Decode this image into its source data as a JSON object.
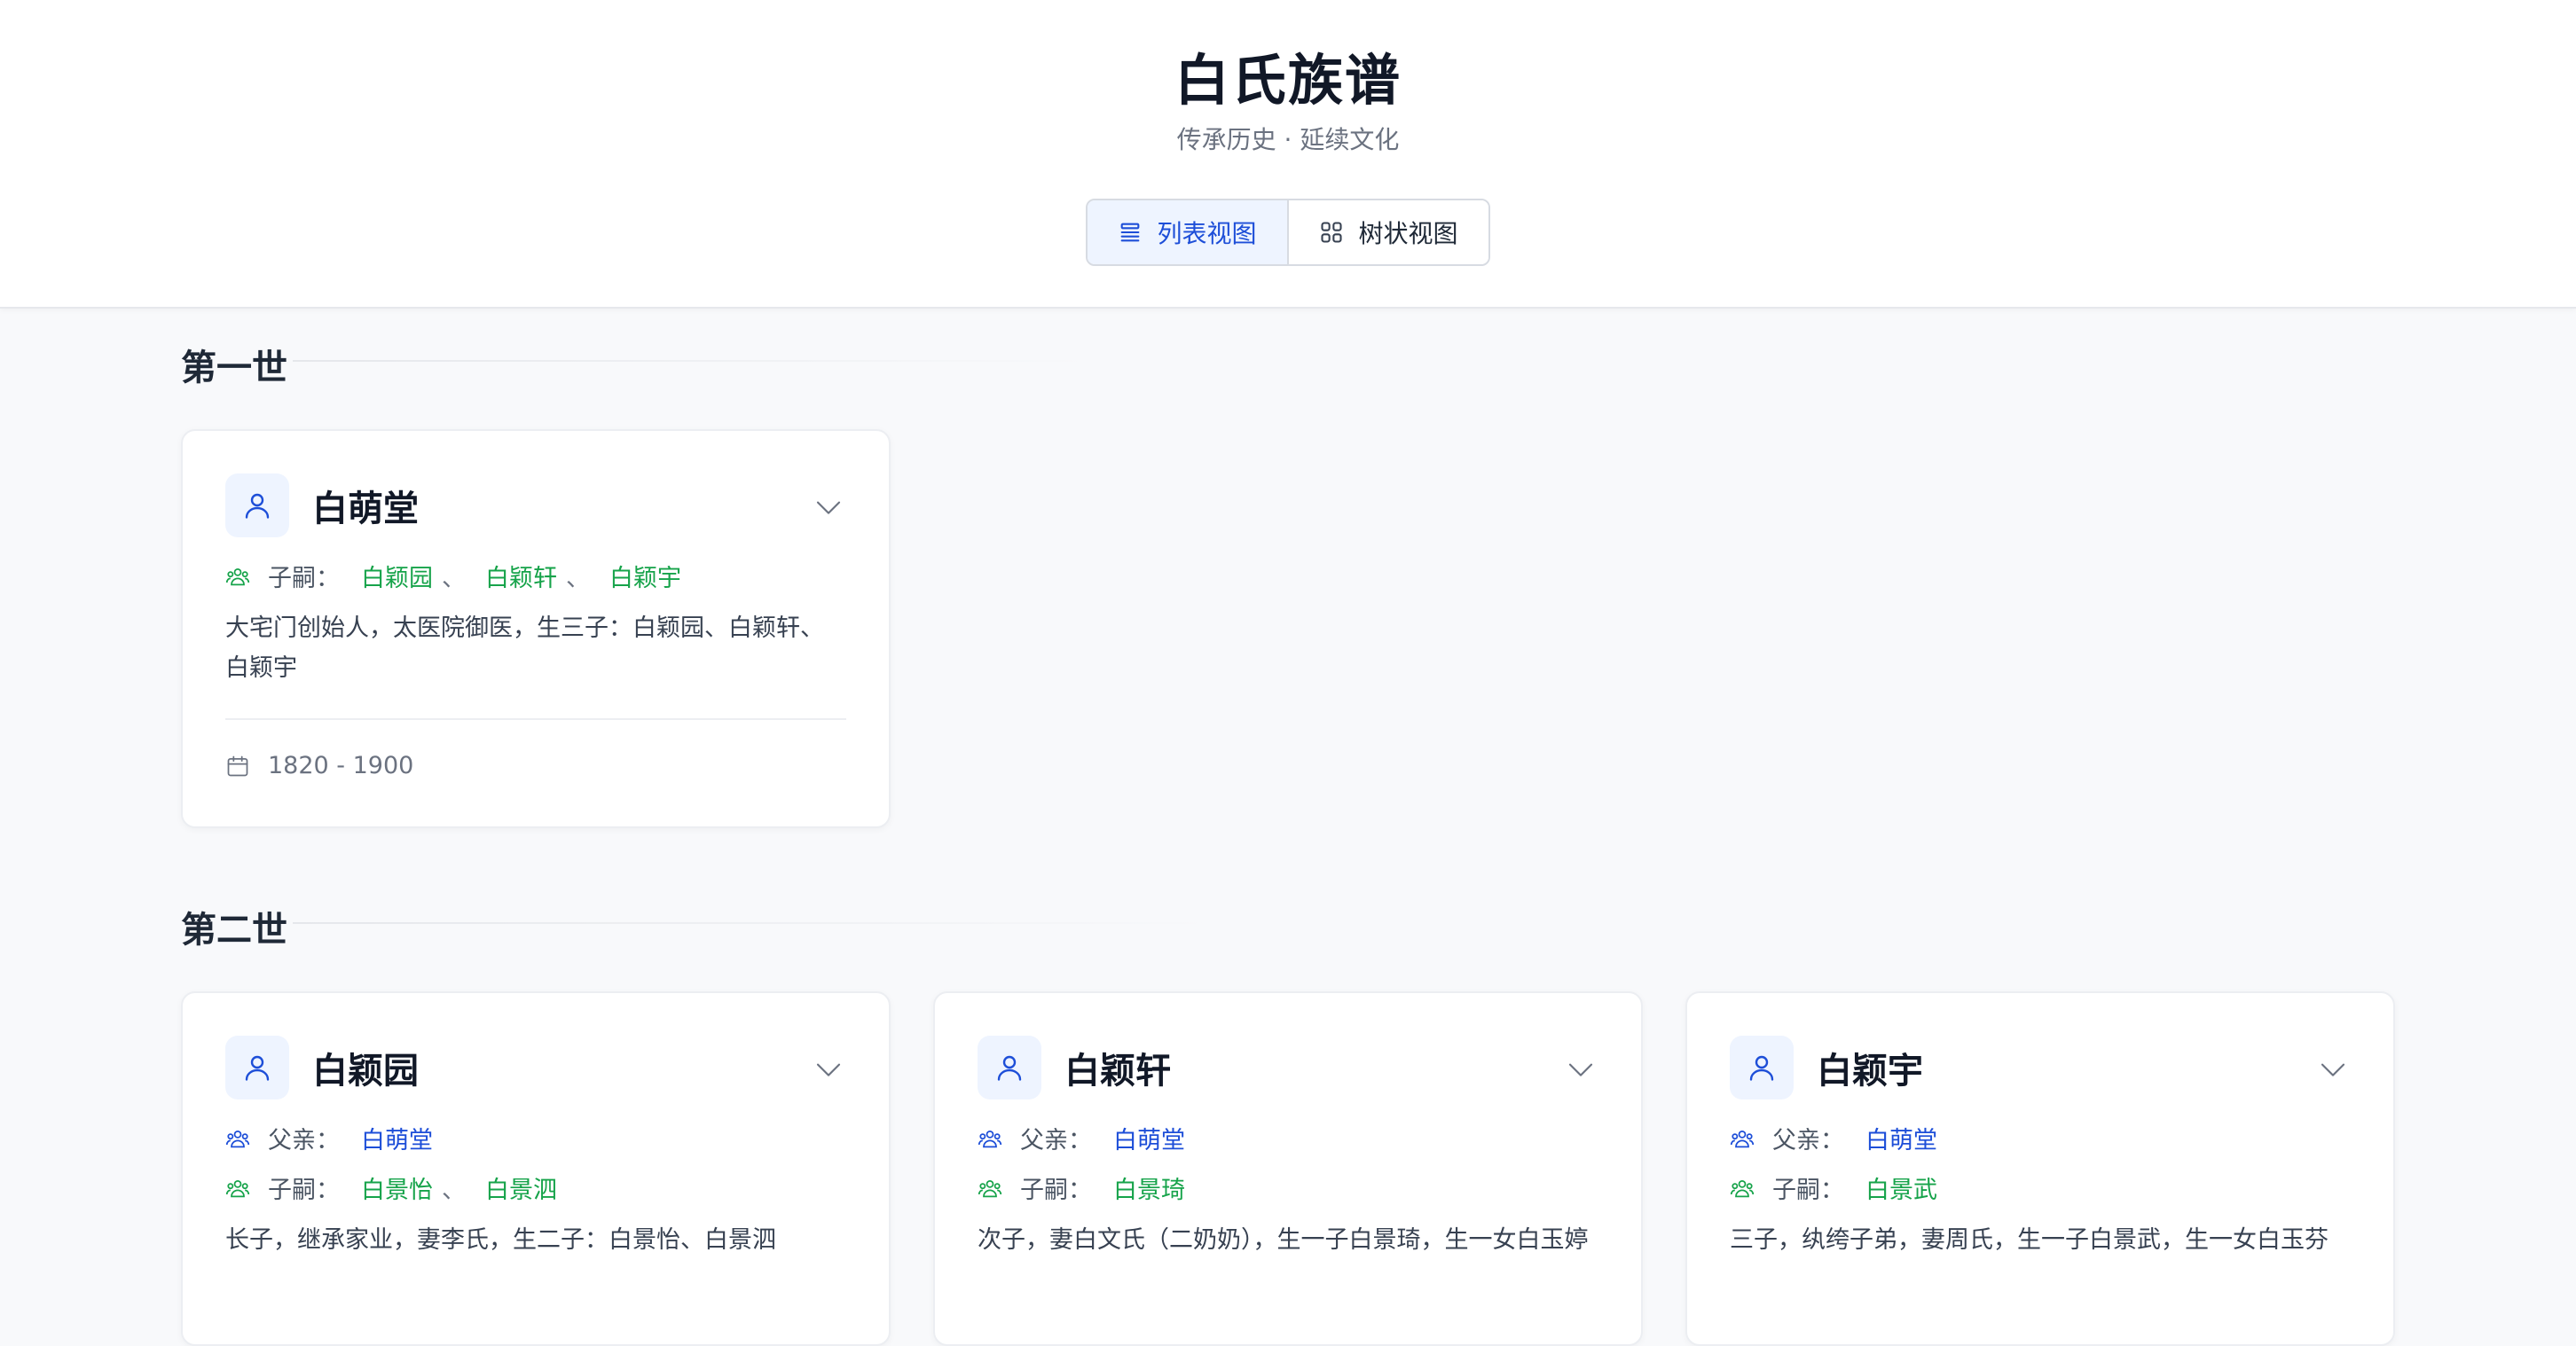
{
  "header": {
    "title": "白氏族谱",
    "subtitle": "传承历史 · 延续文化"
  },
  "view_toggle": {
    "list_label": "列表视图",
    "tree_label": "树状视图",
    "active": "list"
  },
  "labels": {
    "father": "父亲：",
    "children": "子嗣：",
    "separator": "、"
  },
  "colors": {
    "accent_blue": "#1d4ed8",
    "accent_green": "#16a34a"
  },
  "generations": [
    {
      "title": "第一世",
      "members": [
        {
          "name": "白萌堂",
          "children": [
            "白颖园",
            "白颖轩",
            "白颖宇"
          ],
          "description": "大宅门创始人，太医院御医，生三子：白颖园、白颖轩、白颖宇",
          "years": "1820 - 1900"
        }
      ]
    },
    {
      "title": "第二世",
      "members": [
        {
          "name": "白颖园",
          "father": "白萌堂",
          "children": [
            "白景怡",
            "白景泗"
          ],
          "description": "长子，继承家业，妻李氏，生二子：白景怡、白景泗"
        },
        {
          "name": "白颖轩",
          "father": "白萌堂",
          "children": [
            "白景琦"
          ],
          "description": "次子，妻白文氏（二奶奶），生一子白景琦，生一女白玉婷"
        },
        {
          "name": "白颖宇",
          "father": "白萌堂",
          "children": [
            "白景武"
          ],
          "description": "三子，纨绔子弟，妻周氏，生一子白景武，生一女白玉芬"
        }
      ]
    }
  ]
}
